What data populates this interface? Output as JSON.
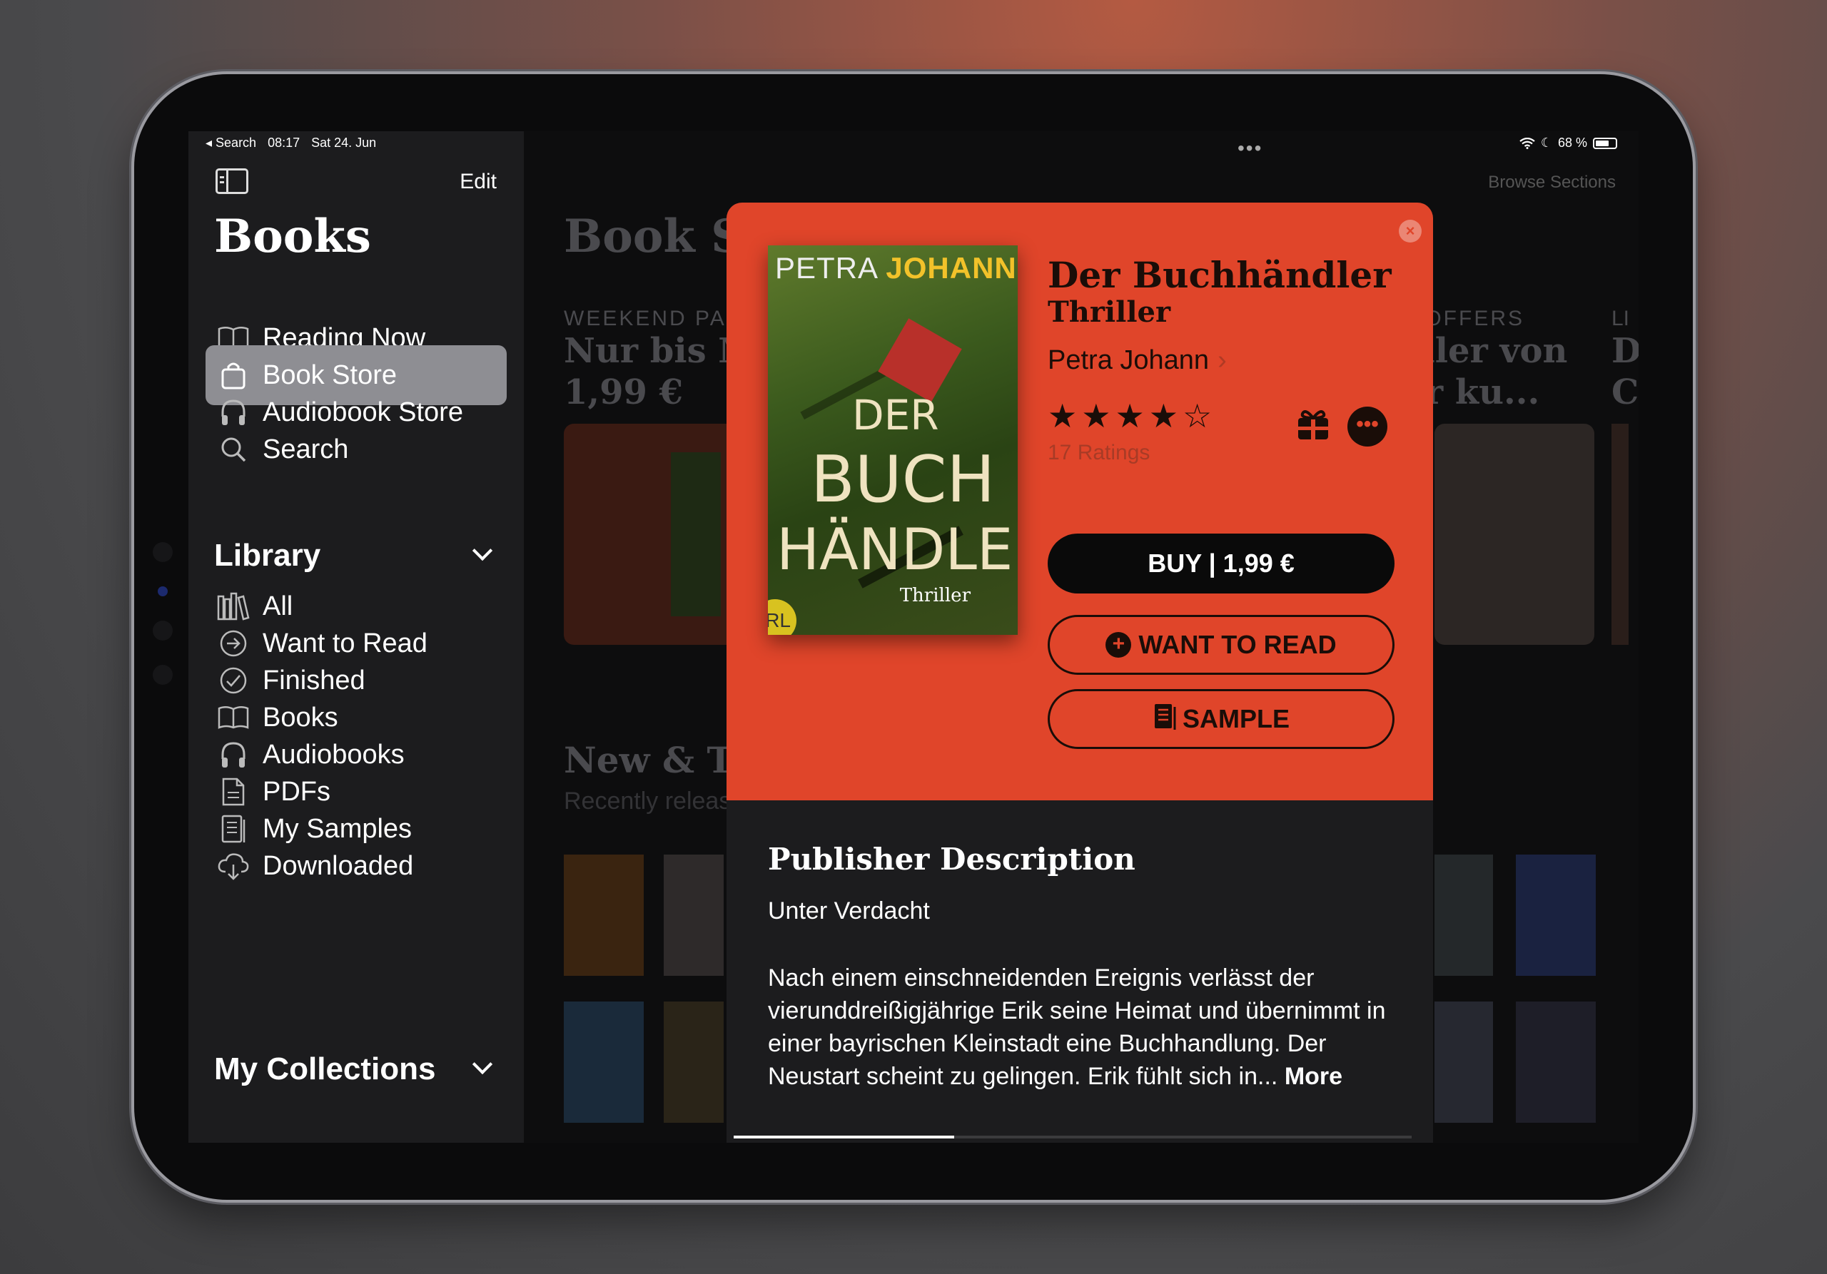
{
  "status_bar": {
    "back_label": "◂ Search",
    "time": "08:17",
    "date": "Sat 24. Jun",
    "battery": "68 %"
  },
  "sidebar": {
    "edit_label": "Edit",
    "title": "Books",
    "items": [
      {
        "label": "Reading Now",
        "icon": "book-open-icon"
      },
      {
        "label": "Book Store",
        "icon": "bag-icon"
      },
      {
        "label": "Audiobook Store",
        "icon": "headphones-icon"
      },
      {
        "label": "Search",
        "icon": "search-icon"
      }
    ],
    "library_header": "Library",
    "library_items": [
      {
        "label": "All",
        "icon": "library-icon"
      },
      {
        "label": "Want to Read",
        "icon": "arrow-circle-icon"
      },
      {
        "label": "Finished",
        "icon": "checkmark-circle-icon"
      },
      {
        "label": "Books",
        "icon": "book-open-icon"
      },
      {
        "label": "Audiobooks",
        "icon": "headphones-icon"
      },
      {
        "label": "PDFs",
        "icon": "document-icon"
      },
      {
        "label": "My Samples",
        "icon": "sample-icon"
      },
      {
        "label": "Downloaded",
        "icon": "cloud-download-icon"
      }
    ],
    "collections_header": "My Collections"
  },
  "main": {
    "page_title": "Book St",
    "browse_sections": "Browse Sections",
    "weekend_label": "WEEKEND PA",
    "weekend_title_1": "Nur bis M",
    "weekend_title_2": "1,99 €",
    "offers_label": "E OFFERS",
    "offers_title_1": "eller von",
    "offers_title_2": "ür ku...",
    "edge_label": "LI",
    "edge_title_1": "D",
    "edge_title_2": "C",
    "new_title": "New & Tr",
    "new_sub": "Recently releas"
  },
  "book": {
    "cover_author_first": "PETRA",
    "cover_author_last": "JOHANN",
    "cover_title_1": "DER",
    "cover_title_2": "BUCH",
    "cover_title_3": "HÄNDLER",
    "cover_subtitle": "Thriller",
    "cover_logo": "RL",
    "title": "Der Buchhändler",
    "genre": "Thriller",
    "author": "Petra Johann",
    "rating_stars": "★★★★☆",
    "rating_value": 4,
    "ratings_count": "17 Ratings",
    "buy_label": "BUY | 1,99 €",
    "want_label": "WANT TO READ",
    "sample_label": "SAMPLE"
  },
  "description": {
    "heading": "Publisher Description",
    "subtitle": "Unter Verdacht",
    "body": "Nach einem einschneidenden Ereignis verlässt der vierunddreißigjährige Erik seine Heimat und übernimmt in einer bayrischen Kleinstadt eine Buchhandlung. Der Neustart scheint zu gelingen. Erik fühlt sich in...",
    "more_label": "More",
    "scroll_progress": 0.325
  },
  "colors": {
    "accent": "#e0452a",
    "sidebar_bg": "#1c1c1e",
    "selected": "#8e8e93"
  }
}
